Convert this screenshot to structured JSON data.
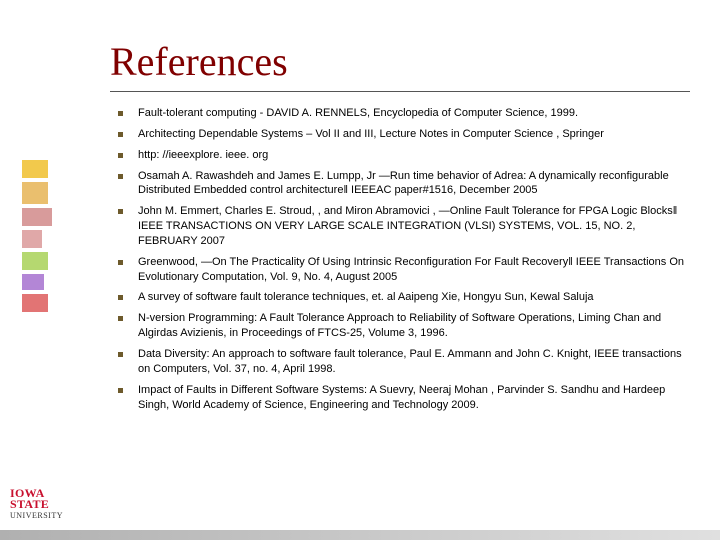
{
  "title": "References",
  "refs": [
    "Fault-tolerant computing - DAVID A. RENNELS, Encyclopedia of Computer Science, 1999.",
    "Architecting Dependable Systems – Vol II and III, Lecture Notes in Computer Science , Springer",
    "http: //ieeexplore. ieee. org",
    "Osamah A. Rawashdeh and James E. Lumpp, Jr ―Run time behavior of Adrea: A dynamically reconfigurable Distributed Embedded control architecture‖ IEEEAC paper#1516, December 2005",
    "John M. Emmert, Charles E. Stroud, , and Miron Abramovici , ―Online Fault Tolerance for FPGA Logic Blocks‖ IEEE TRANSACTIONS ON VERY LARGE SCALE INTEGRATION (VLSI) SYSTEMS, VOL. 15, NO. 2, FEBRUARY 2007",
    "Greenwood, ―On The Practicality Of Using Intrinsic Reconfiguration For Fault Recovery‖ IEEE Transactions On Evolutionary Computation, Vol. 9, No. 4, August 2005",
    "A survey of software fault tolerance techniques, et. al Aaipeng Xie, Hongyu Sun, Kewal Saluja",
    "N-version Programming: A Fault Tolerance Approach to Reliability of Software Operations, Liming Chan and Algirdas Avizienis, in Proceedings of FTCS-25, Volume 3, 1996.",
    "Data Diversity: An approach to software fault tolerance, Paul E. Ammann and John C. Knight, IEEE transactions on Computers, Vol. 37, no. 4, April 1998.",
    "Impact of Faults in Different Software Systems: A Suevry, Neeraj Mohan , Parvinder S. Sandhu and Hardeep Singh, World Academy of Science, Engineering and Technology 2009."
  ],
  "logo": {
    "line1": "IOWA STATE",
    "line2": "UNIVERSITY"
  }
}
